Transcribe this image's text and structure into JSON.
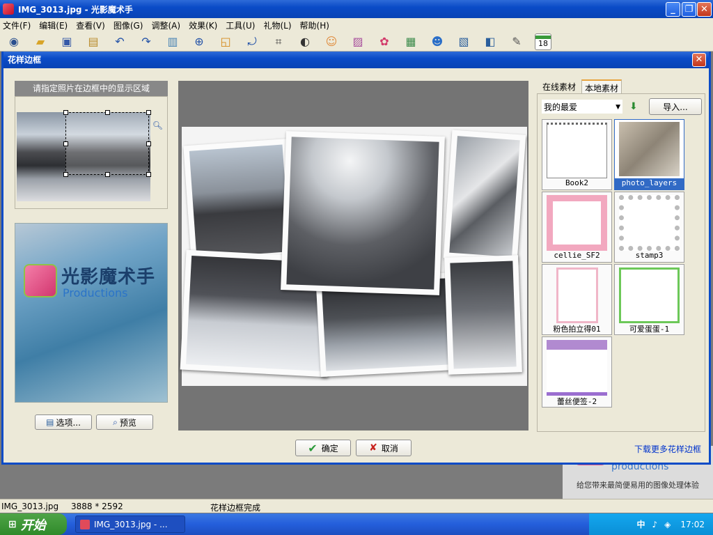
{
  "window": {
    "title": "IMG_3013.jpg - 光影魔术手"
  },
  "menu": [
    "文件(F)",
    "编辑(E)",
    "查看(V)",
    "图像(G)",
    "调整(A)",
    "效果(K)",
    "工具(U)",
    "礼物(L)",
    "帮助(H)"
  ],
  "toolbar_icons": [
    "eye-icon",
    "open-icon",
    "save-icon",
    "saveas-icon",
    "undo-icon",
    "redo-icon",
    "compare-icon",
    "zoom-icon",
    "resize-icon",
    "rotate-icon",
    "crop-icon",
    "exposure-icon",
    "face-icon",
    "mask-icon",
    "color-icon",
    "landscape-icon",
    "avatar-icon",
    "frame-icon",
    "split-icon",
    "tools-icon",
    "calendar-icon"
  ],
  "toolbar_calendar_day": "18",
  "dialog": {
    "title": "花样边框",
    "left_header": "请指定照片在边框中的显示区域",
    "promo_title": "光影魔术手",
    "promo_sub": "Productions",
    "options_button": "选项...",
    "preview_button": "预览",
    "ok_button": "确定",
    "cancel_button": "取消",
    "tabs": [
      "在线素材",
      "本地素材"
    ],
    "active_tab": 1,
    "combo_value": "我的最爱",
    "import_button": "导入...",
    "more_link": "下载更多花样边框",
    "frames": [
      {
        "name": "Book2",
        "selected": false
      },
      {
        "name": "photo_layers",
        "selected": true
      },
      {
        "name": "cellie_SF2",
        "selected": false
      },
      {
        "name": "stamp3",
        "selected": false
      },
      {
        "name": "粉色拍立得01",
        "selected": false
      },
      {
        "name": "可爱蛋蛋-1",
        "selected": false
      },
      {
        "name": "蕾丝便签-2",
        "selected": false
      }
    ]
  },
  "background_promo": {
    "brand": "productions",
    "slogan": "给您带来最简便易用的图像处理体验"
  },
  "status": {
    "file": "IMG_3013.jpg",
    "dims": "3888 * 2592",
    "message": "花样边框完成"
  },
  "taskbar": {
    "start": "开始",
    "task": "IMG_3013.jpg - ...",
    "time": "17:02",
    "ime": "中"
  }
}
